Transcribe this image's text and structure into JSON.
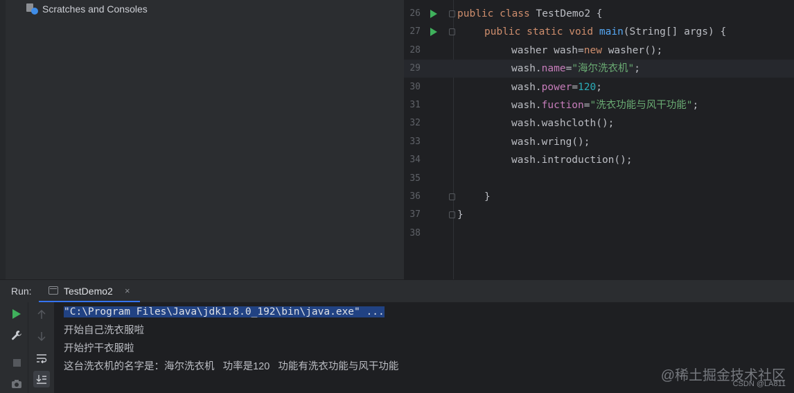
{
  "project": {
    "scratches_label": "Scratches and Consoles"
  },
  "editor": {
    "line_numbers": [
      "26",
      "27",
      "28",
      "29",
      "30",
      "31",
      "32",
      "33",
      "34",
      "35",
      "36",
      "37",
      "38"
    ],
    "code_parts": {
      "l26_kw": "public class ",
      "l26_name": "TestDemo2 {",
      "l27_kw": "public static void ",
      "l27_fn": "main",
      "l27_rest": "(String[] args) {",
      "l28_a": "washer wash=",
      "l28_kw": "new",
      "l28_b": " washer();",
      "wash_prefix": "wash.",
      "l29_field": "name",
      "l29_eq": "=",
      "l29_str": "\"海尔洗衣机\"",
      "semi": ";",
      "l30_field": "power",
      "l30_num": "120",
      "l31_field": "fuction",
      "l31_str": "\"洗衣功能与风干功能\"",
      "l32": "wash.washcloth();",
      "l33": "wash.wring();",
      "l34": "wash.introduction();",
      "l36": "}",
      "l37": "}"
    }
  },
  "run_panel": {
    "label": "Run:",
    "tab_title": "TestDemo2",
    "tab_close": "×",
    "command_line": "\"C:\\Program Files\\Java\\jdk1.8.0_192\\bin\\java.exe\" ...",
    "output_lines": [
      "开始自己洗衣服啦",
      "开始拧干衣服啦",
      "这台洗衣机的名字是：海尔洗衣机   功率是120   功能有洗衣功能与风干功能"
    ]
  },
  "watermark": {
    "text": "@稀土掘金技术社区",
    "sub": "CSDN @LA811"
  },
  "colors": {
    "accent": "#3574f0",
    "run_green": "#3fb15c",
    "keyword": "#cf8e6d",
    "string": "#6aab73",
    "number": "#2aacb8",
    "field": "#c77dbb"
  }
}
